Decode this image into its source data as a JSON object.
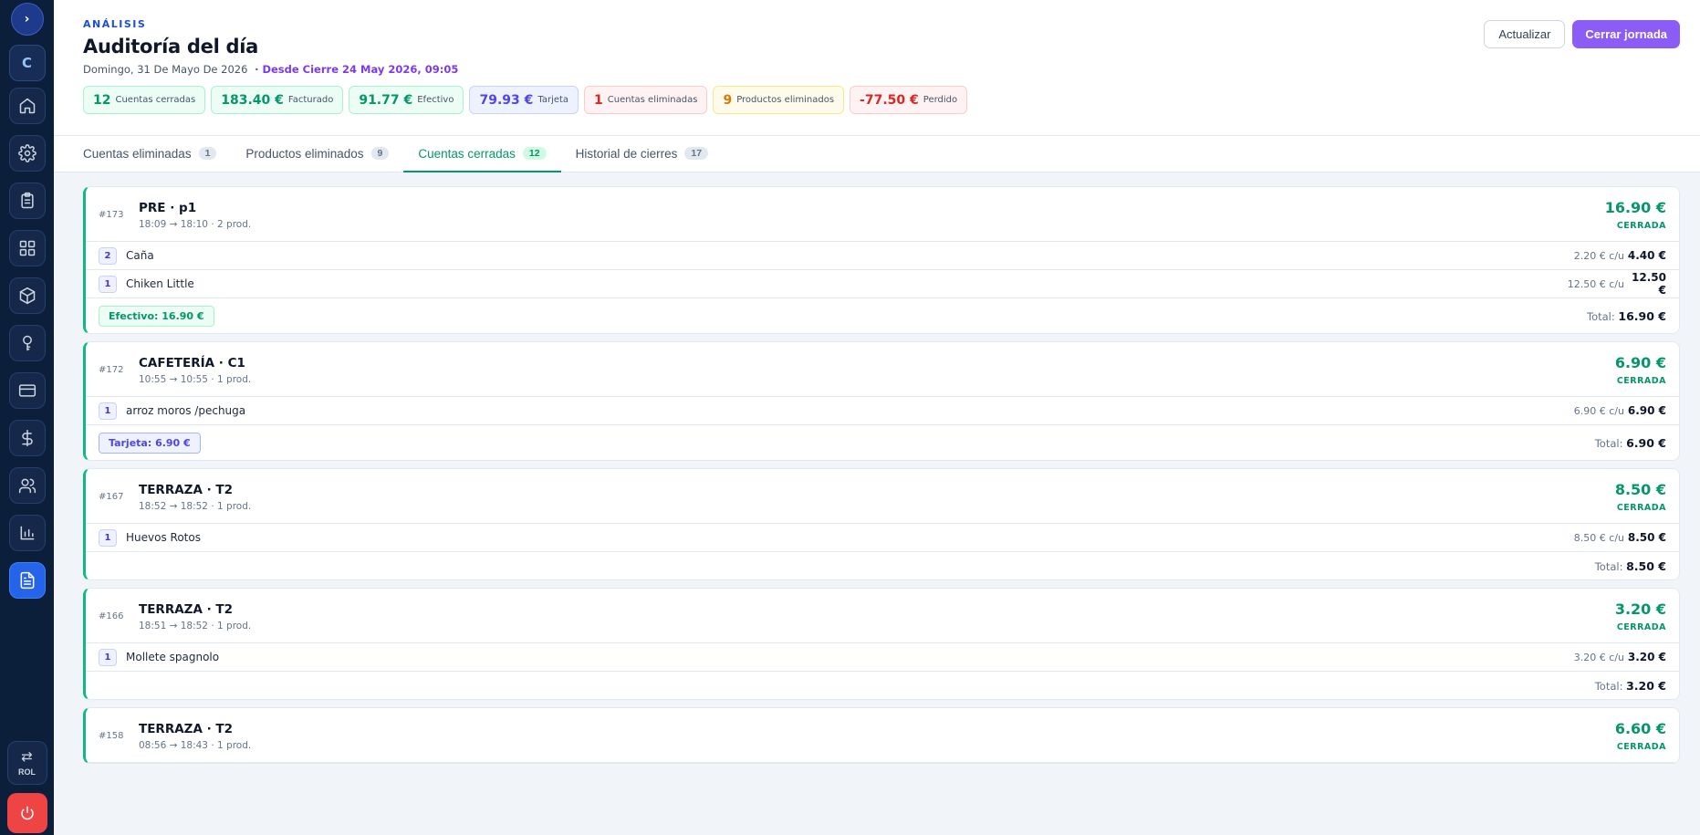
{
  "sidebar": {
    "toggle": "›",
    "logo": "C",
    "items": [
      {
        "name": "home-icon"
      },
      {
        "name": "gear-icon"
      },
      {
        "name": "clipboard-icon"
      },
      {
        "name": "grid-icon"
      },
      {
        "name": "box-icon"
      },
      {
        "name": "key-icon"
      },
      {
        "name": "credit-card-icon"
      },
      {
        "name": "dollar-icon"
      },
      {
        "name": "users-icon"
      },
      {
        "name": "bar-chart-icon"
      },
      {
        "name": "document-icon"
      }
    ],
    "rol_label": "ROL",
    "swap_glyph": "⇄"
  },
  "header": {
    "eyebrow": "ANÁLISIS",
    "title": "Auditoría del día",
    "date": "Domingo, 31 De Mayo De 2026",
    "since": "· Desde Cierre 24 May 2026, 09:05",
    "refresh_label": "Actualizar",
    "close_label": "Cerrar jornada"
  },
  "stats": [
    {
      "value": "12",
      "label": "Cuentas cerradas"
    },
    {
      "value": "183.40 €",
      "label": "Facturado"
    },
    {
      "value": "91.77 €",
      "label": "Efectivo"
    },
    {
      "value": "79.93 €",
      "label": "Tarjeta"
    },
    {
      "value": "1",
      "label": "Cuentas eliminadas"
    },
    {
      "value": "9",
      "label": "Productos eliminados"
    },
    {
      "value": "-77.50 €",
      "label": "Perdido"
    }
  ],
  "tabs": [
    {
      "label": "Cuentas eliminadas",
      "count": "1"
    },
    {
      "label": "Productos eliminados",
      "count": "9"
    },
    {
      "label": "Cuentas cerradas",
      "count": "12"
    },
    {
      "label": "Historial de cierres",
      "count": "17"
    }
  ],
  "cards": [
    {
      "id": "#173",
      "title": "PRE · p1",
      "sub": "18:09 → 18:10 · 2 prod.",
      "amount": "16.90 €",
      "status": "CERRADA",
      "lines": [
        {
          "qty": "2",
          "name": "Caña",
          "unit": "2.20 € c/u",
          "total": "4.40 €"
        },
        {
          "qty": "1",
          "name": "Chiken Little",
          "unit": "12.50 € c/u",
          "total": "12.50 €"
        }
      ],
      "payment": "Efectivo: 16.90 €",
      "total_label": "Total:",
      "total": "16.90 €"
    },
    {
      "id": "#172",
      "title": "CAFETERÍA · C1",
      "sub": "10:55 → 10:55 · 1 prod.",
      "amount": "6.90 €",
      "status": "CERRADA",
      "lines": [
        {
          "qty": "1",
          "name": "arroz moros /pechuga",
          "unit": "6.90 € c/u",
          "total": "6.90 €"
        }
      ],
      "payment": "Tarjeta: 6.90 €",
      "total_label": "Total:",
      "total": "6.90 €"
    },
    {
      "id": "#167",
      "title": "TERRAZA · T2",
      "sub": "18:52 → 18:52 · 1 prod.",
      "amount": "8.50 €",
      "status": "CERRADA",
      "lines": [
        {
          "qty": "1",
          "name": "Huevos Rotos",
          "unit": "8.50 € c/u",
          "total": "8.50 €"
        }
      ],
      "payment": "",
      "total_label": "Total:",
      "total": "8.50 €"
    },
    {
      "id": "#166",
      "title": "TERRAZA · T2",
      "sub": "18:51 → 18:52 · 1 prod.",
      "amount": "3.20 €",
      "status": "CERRADA",
      "lines": [
        {
          "qty": "1",
          "name": "Mollete spagnolo",
          "unit": "3.20 € c/u",
          "total": "3.20 €"
        }
      ],
      "payment": "",
      "total_label": "Total:",
      "total": "3.20 €"
    },
    {
      "id": "#158",
      "title": "TERRAZA · T2",
      "sub": "08:56 → 18:43 · 1 prod.",
      "amount": "6.60 €",
      "status": "CERRADA",
      "lines": [],
      "payment": "",
      "total_label": "",
      "total": ""
    }
  ],
  "colors": {
    "sidebar": "#0b1e3a",
    "accent_green": "#059669",
    "accent_purple": "#8b5cf6",
    "accent_blue": "#1d4ed8",
    "danger": "#ef4444"
  }
}
